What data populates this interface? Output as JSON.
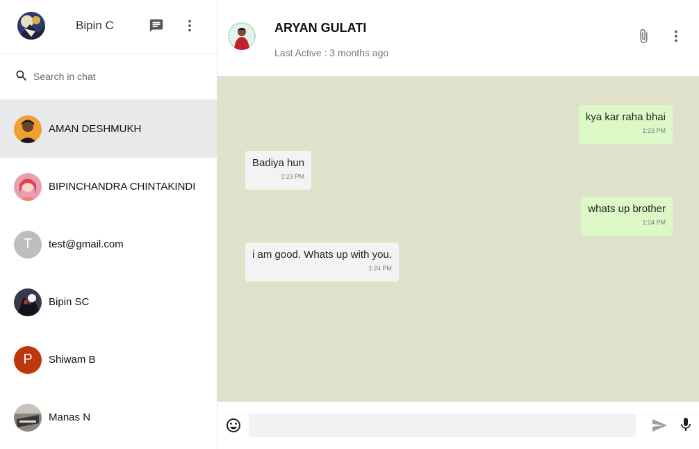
{
  "sidebar": {
    "user_name": "Bipin C",
    "search_placeholder": "Search in chat",
    "contacts": [
      {
        "name": "AMAN DESHMUKH",
        "avatar": "photo",
        "active": true
      },
      {
        "name": "BIPINCHANDRA CHINTAKINDI",
        "avatar": "photo"
      },
      {
        "name": "test@gmail.com",
        "avatar_letter": "T",
        "avatar_color": "#bdbdbd"
      },
      {
        "name": "Bipin SC",
        "avatar": "photo"
      },
      {
        "name": "Shiwam B",
        "avatar_letter": "P",
        "avatar_color": "#c0360c"
      },
      {
        "name": "Manas N",
        "avatar": "photo"
      }
    ]
  },
  "chat": {
    "peer_name": "ARYAN GULATI",
    "peer_status": "Last Active : 3 months ago",
    "messages": [
      {
        "text": "kya kar raha bhai",
        "time": "1:23 PM",
        "direction": "out"
      },
      {
        "text": "Badiya hun",
        "time": "1:23 PM",
        "direction": "in"
      },
      {
        "text": "whats up brother",
        "time": "1:24 PM",
        "direction": "out"
      },
      {
        "text": "i am good. Whats up with you.",
        "time": "1:24 PM",
        "direction": "in"
      }
    ],
    "composer_placeholder": ""
  },
  "colors": {
    "chat_background": "#e0e1cb",
    "outgoing_bubble": "#dcf8c6",
    "incoming_bubble": "#f3f3f3",
    "active_contact": "#e8e9ea"
  },
  "icons": {
    "new_chat": "chat-icon",
    "menu": "more-vert-icon",
    "search": "search-icon",
    "attach": "paperclip-icon",
    "emoji": "emoji-icon",
    "send": "send-icon",
    "mic": "mic-icon"
  }
}
